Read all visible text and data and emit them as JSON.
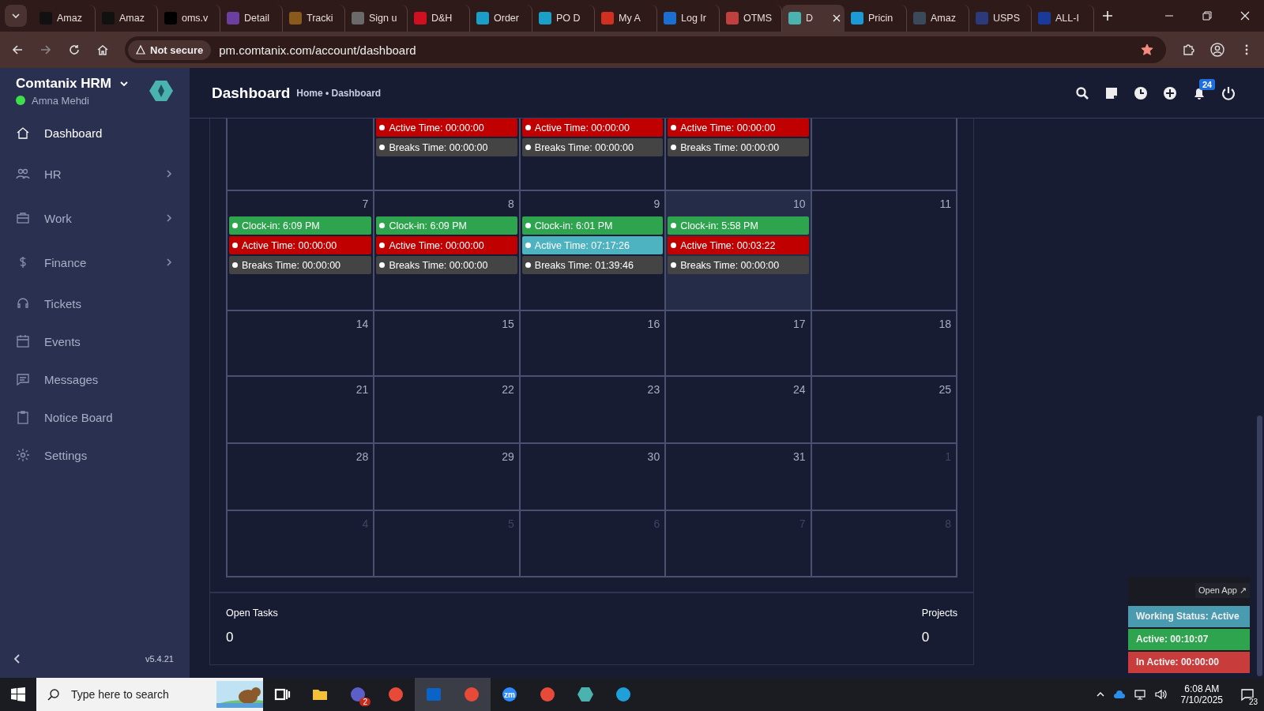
{
  "browser": {
    "tabs": [
      {
        "label": "Amaz",
        "selected": false,
        "color": "#111111"
      },
      {
        "label": "Amaz",
        "selected": false,
        "color": "#111111"
      },
      {
        "label": "oms.v",
        "selected": false,
        "color": "#000000"
      },
      {
        "label": "Detail",
        "selected": false,
        "color": "#6b3fa0"
      },
      {
        "label": "Tracki",
        "selected": false,
        "color": "#8a5a1c"
      },
      {
        "label": "Sign u",
        "selected": false,
        "color": "#6a6a6a"
      },
      {
        "label": "D&H",
        "selected": false,
        "color": "#d01020"
      },
      {
        "label": "Order",
        "selected": false,
        "color": "#1aa0c8"
      },
      {
        "label": "PO D",
        "selected": false,
        "color": "#1aa0c8"
      },
      {
        "label": "My A",
        "selected": false,
        "color": "#d03020"
      },
      {
        "label": "Log Ir",
        "selected": false,
        "color": "#1a6fd0"
      },
      {
        "label": "OTMS",
        "selected": false,
        "color": "#c04040"
      },
      {
        "label": "D",
        "selected": true,
        "color": "#4ab3b0"
      },
      {
        "label": "Pricin",
        "selected": false,
        "color": "#1a9ad6"
      },
      {
        "label": "Amaz",
        "selected": false,
        "color": "#3a4a5a"
      },
      {
        "label": "USPS",
        "selected": false,
        "color": "#2a3a7a"
      },
      {
        "label": "ALL-I",
        "selected": false,
        "color": "#1a3a9a"
      }
    ],
    "security": "Not secure",
    "url": "pm.comtanix.com/account/dashboard",
    "bookmarked": true
  },
  "sidebar": {
    "brand": "Comtanix HRM",
    "user": "Amna Mehdi",
    "online": true,
    "items": [
      {
        "label": "Dashboard",
        "kind": "home",
        "selected": true,
        "submenu": false
      },
      {
        "label": "HR",
        "kind": "people",
        "selected": false,
        "submenu": true
      },
      {
        "label": "Work",
        "kind": "briefcase",
        "selected": false,
        "submenu": true
      },
      {
        "label": "Finance",
        "kind": "dollar",
        "selected": false,
        "submenu": true
      },
      {
        "label": "Tickets",
        "kind": "headset",
        "selected": false,
        "submenu": false
      },
      {
        "label": "Events",
        "kind": "calendar",
        "selected": false,
        "submenu": false
      },
      {
        "label": "Messages",
        "kind": "message",
        "selected": false,
        "submenu": false
      },
      {
        "label": "Notice Board",
        "kind": "clipboard",
        "selected": false,
        "submenu": false
      },
      {
        "label": "Settings",
        "kind": "gear",
        "selected": false,
        "submenu": false
      }
    ],
    "version": "v5.4.21"
  },
  "header": {
    "title": "Dashboard",
    "breadcrumb": "Home • Dashboard",
    "notifications": "24"
  },
  "calendar": {
    "weeks": [
      {
        "days": [
          {
            "today": false
          },
          {
            "entries": [
              {
                "text": "Active Time: 00:00:00",
                "color": "#c00000"
              },
              {
                "text": "Breaks Time: 00:00:00",
                "color": "#444444"
              }
            ]
          },
          {
            "entries": [
              {
                "text": "Active Time: 00:00:00",
                "color": "#c00000"
              },
              {
                "text": "Breaks Time: 00:00:00",
                "color": "#444444"
              }
            ]
          },
          {
            "entries": [
              {
                "text": "Active Time: 00:00:00",
                "color": "#c00000"
              },
              {
                "text": "Breaks Time: 00:00:00",
                "color": "#444444"
              }
            ]
          },
          {
            "today": false
          }
        ]
      },
      {
        "days": [
          {
            "number": "7",
            "muted": false,
            "today": false,
            "entries": [
              {
                "text": "Clock-in: 6:09 PM",
                "color": "#2ea44f"
              },
              {
                "text": "Active Time: 00:00:00",
                "color": "#c00000"
              },
              {
                "text": "Breaks Time: 00:00:00",
                "color": "#444444"
              }
            ]
          },
          {
            "number": "8",
            "muted": false,
            "today": false,
            "entries": [
              {
                "text": "Clock-in: 6:09 PM",
                "color": "#2ea44f"
              },
              {
                "text": "Active Time: 00:00:00",
                "color": "#c00000"
              },
              {
                "text": "Breaks Time: 00:00:00",
                "color": "#444444"
              }
            ]
          },
          {
            "number": "9",
            "muted": false,
            "today": false,
            "entries": [
              {
                "text": "Clock-in: 6:01 PM",
                "color": "#2ea44f"
              },
              {
                "text": "Active Time: 07:17:26",
                "color": "#4eb3c0"
              },
              {
                "text": "Breaks Time: 01:39:46",
                "color": "#444444"
              }
            ]
          },
          {
            "number": "10",
            "muted": false,
            "today": true,
            "entries": [
              {
                "text": "Clock-in: 5:58 PM",
                "color": "#2ea44f"
              },
              {
                "text": "Active Time: 00:03:22",
                "color": "#c00000"
              },
              {
                "text": "Breaks Time: 00:00:00",
                "color": "#444444"
              }
            ]
          },
          {
            "number": "11",
            "muted": false,
            "today": false
          }
        ]
      },
      {
        "days": [
          {
            "number": "14",
            "muted": false,
            "today": false
          },
          {
            "number": "15",
            "muted": false,
            "today": false
          },
          {
            "number": "16",
            "muted": false,
            "today": false
          },
          {
            "number": "17",
            "muted": false,
            "today": false
          },
          {
            "number": "18",
            "muted": false,
            "today": false
          }
        ]
      },
      {
        "days": [
          {
            "number": "21",
            "muted": false,
            "today": false
          },
          {
            "number": "22",
            "muted": false,
            "today": false
          },
          {
            "number": "23",
            "muted": false,
            "today": false
          },
          {
            "number": "24",
            "muted": false,
            "today": false
          },
          {
            "number": "25",
            "muted": false,
            "today": false
          }
        ]
      },
      {
        "days": [
          {
            "number": "28",
            "muted": false,
            "today": false
          },
          {
            "number": "29",
            "muted": false,
            "today": false
          },
          {
            "number": "30",
            "muted": false,
            "today": false
          },
          {
            "number": "31",
            "muted": false,
            "today": false
          },
          {
            "number": "1",
            "muted": true,
            "today": false
          }
        ]
      },
      {
        "days": [
          {
            "number": "4",
            "muted": true,
            "today": false
          },
          {
            "number": "5",
            "muted": true,
            "today": false
          },
          {
            "number": "6",
            "muted": true,
            "today": false
          },
          {
            "number": "7",
            "muted": true,
            "today": false
          },
          {
            "number": "8",
            "muted": true,
            "today": false
          }
        ]
      }
    ]
  },
  "stats": [
    {
      "label": "Open Tasks",
      "value": "0"
    },
    {
      "label": "Projects",
      "value": "0"
    }
  ],
  "widget": {
    "link": "Open App ↗",
    "rows": [
      {
        "text": "Working Status: Active",
        "color": "#4a9bb0"
      },
      {
        "text": "Active: 00:10:07",
        "color": "#2ea44f"
      },
      {
        "text": "In Active: 00:00:00",
        "color": "#c83c3c"
      }
    ]
  },
  "taskbar": {
    "search": {
      "placeholder": "Type here to search"
    },
    "apps": [
      {
        "kind": "taskview",
        "selected": false,
        "color": "#ffffff"
      },
      {
        "kind": "folder",
        "selected": false,
        "color": "#f3c03a"
      },
      {
        "kind": "circle",
        "selected": false,
        "color": "#5b5fc7",
        "badge": "2"
      },
      {
        "kind": "circle",
        "selected": false,
        "color": "#e84a3a"
      },
      {
        "kind": "square",
        "selected": true,
        "color": "#0a64c8"
      },
      {
        "kind": "circle",
        "selected": true,
        "color": "#e84a3a"
      },
      {
        "kind": "circle",
        "selected": false,
        "color": "#2d8cff",
        "label": "zm"
      },
      {
        "kind": "circle",
        "selected": false,
        "color": "#e84a3a"
      },
      {
        "kind": "hexagon",
        "selected": false,
        "color": "#4ab3b0"
      },
      {
        "kind": "circle",
        "selected": false,
        "color": "#1fa0d8"
      }
    ],
    "time": "6:08 AM",
    "date": "7/10/2025",
    "notifications": "23"
  }
}
